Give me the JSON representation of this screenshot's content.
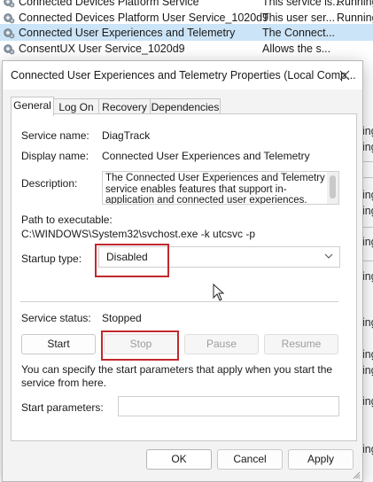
{
  "services_list": {
    "rows": [
      {
        "name": "Connected Devices Platform Service",
        "description": "This service is...",
        "status": "Running"
      },
      {
        "name": "Connected Devices Platform User Service_1020d9",
        "description": "This user ser...",
        "status": "Running"
      },
      {
        "name": "Connected User Experiences and Telemetry",
        "description": "The Connect...",
        "status": ""
      },
      {
        "name": "ConsentUX User Service_1020d9",
        "description": "Allows the s...",
        "status": ""
      }
    ],
    "right_fragments": [
      "ning",
      "ning",
      "ning",
      "ning",
      "ning",
      "ning",
      "ning",
      "ning",
      "ning",
      "ning",
      "ning"
    ]
  },
  "dialog": {
    "title": "Connected User Experiences and Telemetry Properties (Local Comp...",
    "tabs": [
      {
        "label": "General",
        "active": true
      },
      {
        "label": "Log On",
        "active": false
      },
      {
        "label": "Recovery",
        "active": false
      },
      {
        "label": "Dependencies",
        "active": false
      }
    ],
    "general": {
      "service_name_label": "Service name:",
      "service_name": "DiagTrack",
      "display_name_label": "Display name:",
      "display_name": "Connected User Experiences and Telemetry",
      "description_label": "Description:",
      "description": "The Connected User Experiences and Telemetry service enables features that support in-application and connected user experiences. Additionally, this",
      "path_label": "Path to executable:",
      "path": "C:\\WINDOWS\\System32\\svchost.exe -k utcsvc -p",
      "startup_type_label": "Startup type:",
      "startup_type": "Disabled",
      "service_status_label": "Service status:",
      "service_status": "Stopped",
      "buttons": {
        "start": "Start",
        "stop": "Stop",
        "pause": "Pause",
        "resume": "Resume"
      },
      "help_text": "You can specify the start parameters that apply when you start the service from here.",
      "start_params_label": "Start parameters:",
      "start_params_value": ""
    },
    "footer": {
      "ok": "OK",
      "cancel": "Cancel",
      "apply": "Apply"
    }
  },
  "colors": {
    "highlight_red": "#c0292e",
    "selected_row": "#cce4f7",
    "accent": "#0067c0"
  }
}
